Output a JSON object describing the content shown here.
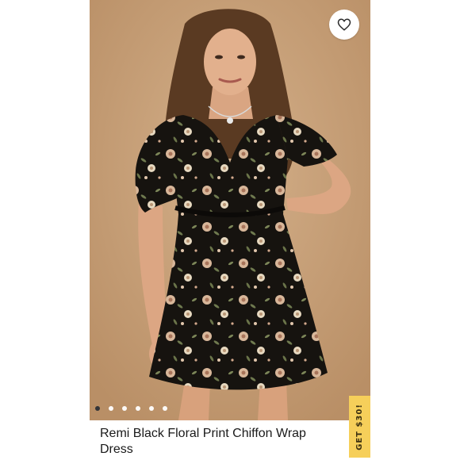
{
  "listing": {
    "title": "Remi Black Floral Print Chiffon Wrap Dress",
    "promo_label": "GET $30!",
    "image_subject": "model-wearing-black-floral-dress",
    "carousel": {
      "count": 6,
      "active_index": 0
    }
  },
  "icons": {
    "like": "heart-icon"
  },
  "colors": {
    "photo_background": "#c9a37d",
    "promo_tab": "#f6cf5a",
    "active_dot": "#2b2f36",
    "inactive_dot": "#ffffff"
  }
}
